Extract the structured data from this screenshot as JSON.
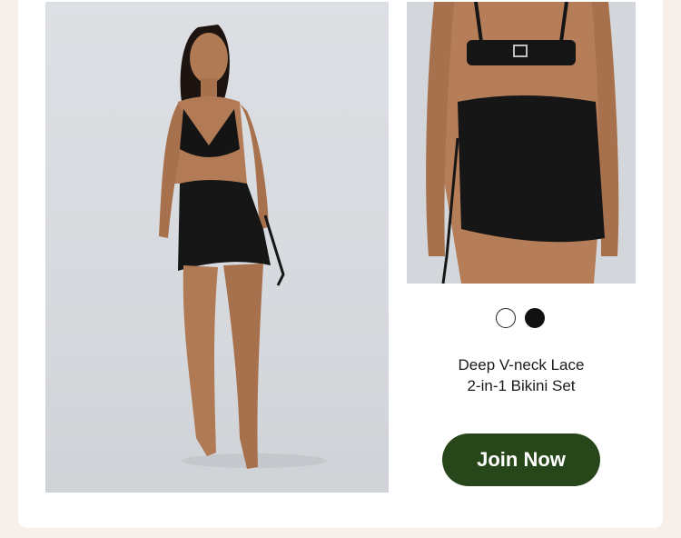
{
  "product": {
    "title_line1": "Deep V-neck Lace",
    "title_line2": "2-in-1 Bikini Set",
    "colors": [
      {
        "name": "white",
        "hex": "#ffffff"
      },
      {
        "name": "black",
        "hex": "#111111"
      }
    ]
  },
  "cta": {
    "label": "Join Now",
    "color": "#27471b"
  }
}
